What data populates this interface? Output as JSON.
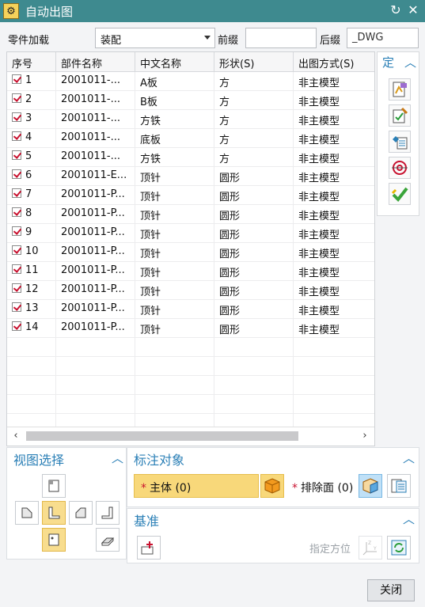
{
  "window": {
    "title": "自动出图"
  },
  "form": {
    "part_load_label": "零件加载",
    "part_load_value": "装配",
    "prefix_label": "前缀",
    "prefix_value": "",
    "suffix_label": "后缀",
    "suffix_value": "_DWG"
  },
  "table": {
    "columns": [
      "序号",
      "部件名称",
      "中文名称",
      "形状(S)",
      "出图方式(S)"
    ],
    "rows": [
      {
        "checked": true,
        "no": "1",
        "part": "2001011-...",
        "name": "A板",
        "shape": "方",
        "mode": "非主模型"
      },
      {
        "checked": true,
        "no": "2",
        "part": "2001011-...",
        "name": "B板",
        "shape": "方",
        "mode": "非主模型"
      },
      {
        "checked": true,
        "no": "3",
        "part": "2001011-...",
        "name": "方铁",
        "shape": "方",
        "mode": "非主模型"
      },
      {
        "checked": true,
        "no": "4",
        "part": "2001011-...",
        "name": "底板",
        "shape": "方",
        "mode": "非主模型"
      },
      {
        "checked": true,
        "no": "5",
        "part": "2001011-...",
        "name": "方铁",
        "shape": "方",
        "mode": "非主模型"
      },
      {
        "checked": true,
        "no": "6",
        "part": "2001011-E...",
        "name": "顶针",
        "shape": "圆形",
        "mode": "非主模型"
      },
      {
        "checked": true,
        "no": "7",
        "part": "2001011-P...",
        "name": "顶针",
        "shape": "圆形",
        "mode": "非主模型"
      },
      {
        "checked": true,
        "no": "8",
        "part": "2001011-P...",
        "name": "顶针",
        "shape": "圆形",
        "mode": "非主模型"
      },
      {
        "checked": true,
        "no": "9",
        "part": "2001011-P...",
        "name": "顶针",
        "shape": "圆形",
        "mode": "非主模型"
      },
      {
        "checked": true,
        "no": "10",
        "part": "2001011-P...",
        "name": "顶针",
        "shape": "圆形",
        "mode": "非主模型"
      },
      {
        "checked": true,
        "no": "11",
        "part": "2001011-P...",
        "name": "顶针",
        "shape": "圆形",
        "mode": "非主模型"
      },
      {
        "checked": true,
        "no": "12",
        "part": "2001011-P...",
        "name": "顶针",
        "shape": "圆形",
        "mode": "非主模型"
      },
      {
        "checked": true,
        "no": "13",
        "part": "2001011-P...",
        "name": "顶针",
        "shape": "圆形",
        "mode": "非主模型"
      },
      {
        "checked": true,
        "no": "14",
        "part": "2001011-P...",
        "name": "顶针",
        "shape": "圆形",
        "mode": "非主模型"
      }
    ],
    "empty_rows": 6
  },
  "side_toolbar": {
    "header": "定",
    "icons": [
      "sheet-template-icon",
      "edit-sheet-icon",
      "view-list-icon",
      "target-icon",
      "check-apply-icon"
    ]
  },
  "view_select": {
    "header": "视图选择",
    "icons": [
      "top-view-icon",
      "left-view-icon",
      "front-view-icon",
      "right-view-icon",
      "back-view-icon",
      "bottom-view-icon",
      "isometric-view-icon"
    ]
  },
  "annotation": {
    "header": "标注对象",
    "body_label": "主体 (0)",
    "exclude_label": "排除面 (0)",
    "required_mark": "*"
  },
  "datum": {
    "header": "基准",
    "orientation_label": "指定方位"
  },
  "buttons": {
    "close": "关闭"
  },
  "colors": {
    "titlebar": "#3e8a8f",
    "accent": "#2a7fb6",
    "highlight": "#f8d87a",
    "checkmark": "#c8102e"
  }
}
